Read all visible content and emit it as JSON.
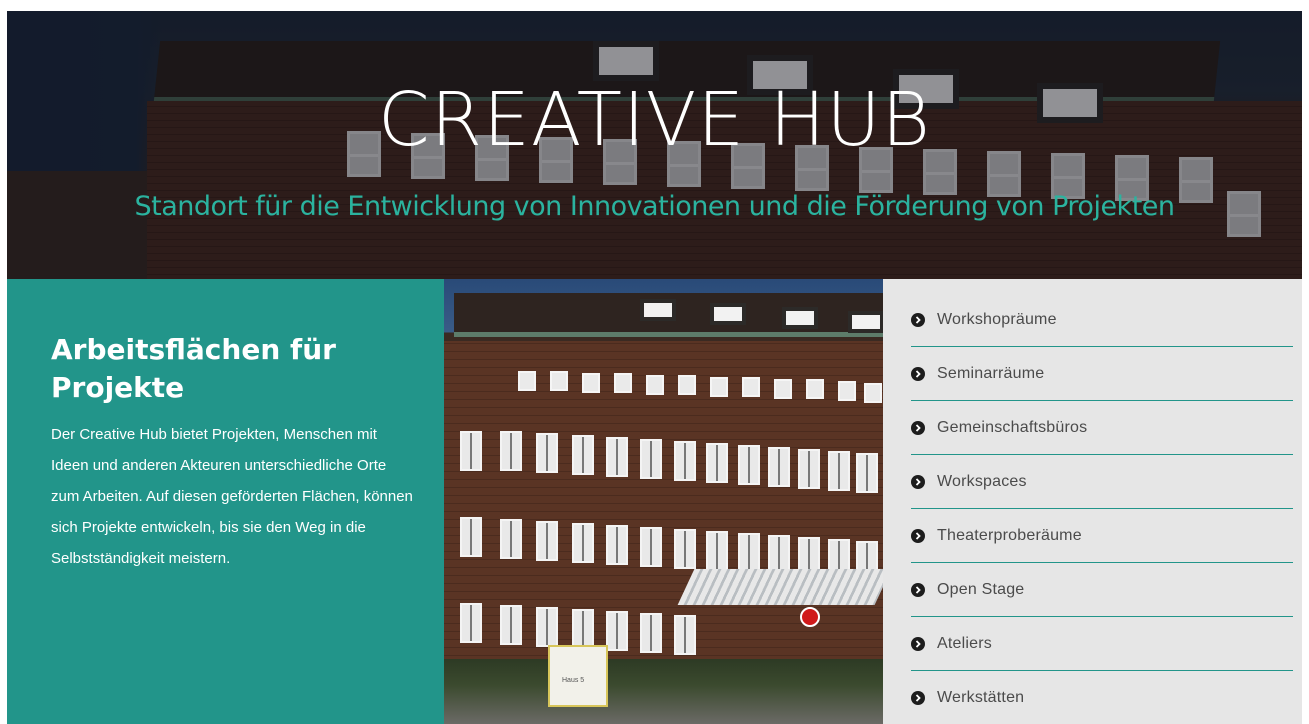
{
  "hero": {
    "title": "CREATIVE HUB",
    "subtitle": "Standort für die Entwicklung von Innovationen und die Förderung von Projekten"
  },
  "intro": {
    "heading": "Arbeitsflächen für Projekte",
    "text": "Der Creative Hub bietet Projekten, Menschen mit Ideen und anderen Akteuren unterschiedliche Orte zum Arbeiten. Auf diesen geförderten Flächen, können sich Projekte entwickeln, bis sie den Weg in die Selbstständigkeit meistern."
  },
  "photo": {
    "sign_text": "Haus 5"
  },
  "space_list": {
    "icon": "chevron-circle-right-icon",
    "items": [
      {
        "label": "Workshopräume"
      },
      {
        "label": "Seminarräume"
      },
      {
        "label": "Gemeinschaftsbüros"
      },
      {
        "label": "Workspaces"
      },
      {
        "label": "Theaterproberäume"
      },
      {
        "label": "Open Stage"
      },
      {
        "label": "Ateliers"
      },
      {
        "label": "Werkstätten"
      }
    ]
  },
  "colors": {
    "accent": "#22958a",
    "subtitle": "#2bb39f",
    "list_background": "#e6e6e6",
    "list_text": "#4b4b4b"
  }
}
